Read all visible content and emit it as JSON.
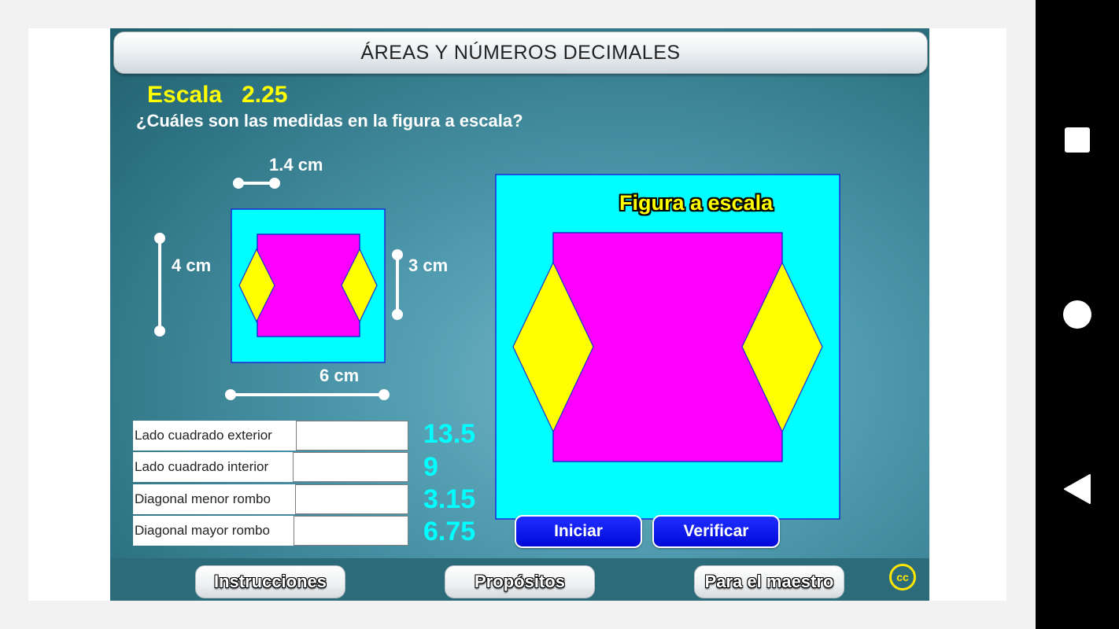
{
  "header": {
    "title": "ÁREAS Y NÚMEROS DECIMALES"
  },
  "scale": {
    "text": "Escala   2.25"
  },
  "question": "¿Cuáles son las medidas en la figura a escala?",
  "original_figure": {
    "dim_top": "1.4 cm",
    "dim_left": "4 cm",
    "dim_right": "3 cm",
    "dim_bottom": "6 cm"
  },
  "scaled_figure": {
    "title": "Figura a escala"
  },
  "form": {
    "rows": [
      {
        "label": "Lado cuadrado exterior",
        "value": "",
        "answer": "13.5"
      },
      {
        "label": "Lado cuadrado interior",
        "value": "",
        "answer": "9"
      },
      {
        "label": "Diagonal menor rombo",
        "value": "",
        "answer": "3.15"
      },
      {
        "label": "Diagonal mayor rombo",
        "value": "",
        "answer": "6.75"
      }
    ]
  },
  "buttons": {
    "start": "Iniciar",
    "verify": "Verificar"
  },
  "bottom_nav": {
    "instructions": "Instrucciones",
    "purposes": "Propósitos",
    "teacher": "Para el maestro"
  },
  "license_icon": "cc",
  "android_nav": {
    "recent": "square-icon",
    "home": "circle-icon",
    "back": "triangle-back-icon"
  },
  "colors": {
    "outer_square": "#00ffff",
    "inner_square": "#ff00ff",
    "rhombus": "#ffff00",
    "scale_label": "#ffff00",
    "answers": "#00ffff",
    "primary_button": "#0008d8"
  }
}
